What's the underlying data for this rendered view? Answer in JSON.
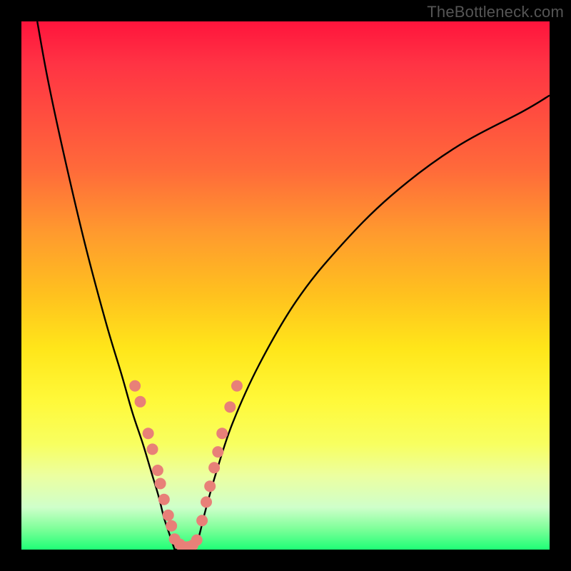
{
  "watermark": "TheBottleneck.com",
  "chart_data": {
    "type": "line",
    "title": "",
    "xlabel": "",
    "ylabel": "",
    "xlim": [
      0,
      100
    ],
    "ylim": [
      0,
      100
    ],
    "series": [
      {
        "name": "left-curve",
        "x": [
          3,
          5,
          8,
          12,
          16,
          19,
          21,
          23,
          24.5,
          26,
          27,
          28,
          29
        ],
        "values": [
          100,
          89,
          75,
          58,
          43,
          33,
          26,
          20,
          15,
          10,
          6,
          3,
          0
        ]
      },
      {
        "name": "right-curve",
        "x": [
          33,
          34,
          35,
          37,
          40,
          45,
          52,
          60,
          70,
          82,
          95,
          100
        ],
        "values": [
          0,
          4,
          8,
          15,
          24,
          35,
          47,
          57,
          67,
          76,
          83,
          86
        ]
      },
      {
        "name": "valley-floor",
        "x": [
          29,
          30,
          31,
          32,
          33
        ],
        "values": [
          0,
          0,
          0,
          0,
          0
        ]
      }
    ],
    "scatter_points": {
      "name": "markers",
      "color": "#e88078",
      "points": [
        {
          "x": 21.5,
          "y": 31
        },
        {
          "x": 22.5,
          "y": 28
        },
        {
          "x": 24,
          "y": 22
        },
        {
          "x": 24.8,
          "y": 19
        },
        {
          "x": 25.8,
          "y": 15
        },
        {
          "x": 26.3,
          "y": 12.5
        },
        {
          "x": 27,
          "y": 9.5
        },
        {
          "x": 27.8,
          "y": 6.5
        },
        {
          "x": 28.4,
          "y": 4.5
        },
        {
          "x": 29,
          "y": 2
        },
        {
          "x": 30,
          "y": 1
        },
        {
          "x": 30.8,
          "y": 0.5
        },
        {
          "x": 31.6,
          "y": 0.5
        },
        {
          "x": 32.4,
          "y": 0.8
        },
        {
          "x": 33.2,
          "y": 1.8
        },
        {
          "x": 34.2,
          "y": 5.5
        },
        {
          "x": 35,
          "y": 9
        },
        {
          "x": 35.7,
          "y": 12
        },
        {
          "x": 36.5,
          "y": 15.5
        },
        {
          "x": 37.2,
          "y": 18.5
        },
        {
          "x": 38,
          "y": 22
        },
        {
          "x": 39.5,
          "y": 27
        },
        {
          "x": 40.8,
          "y": 31
        }
      ]
    }
  }
}
